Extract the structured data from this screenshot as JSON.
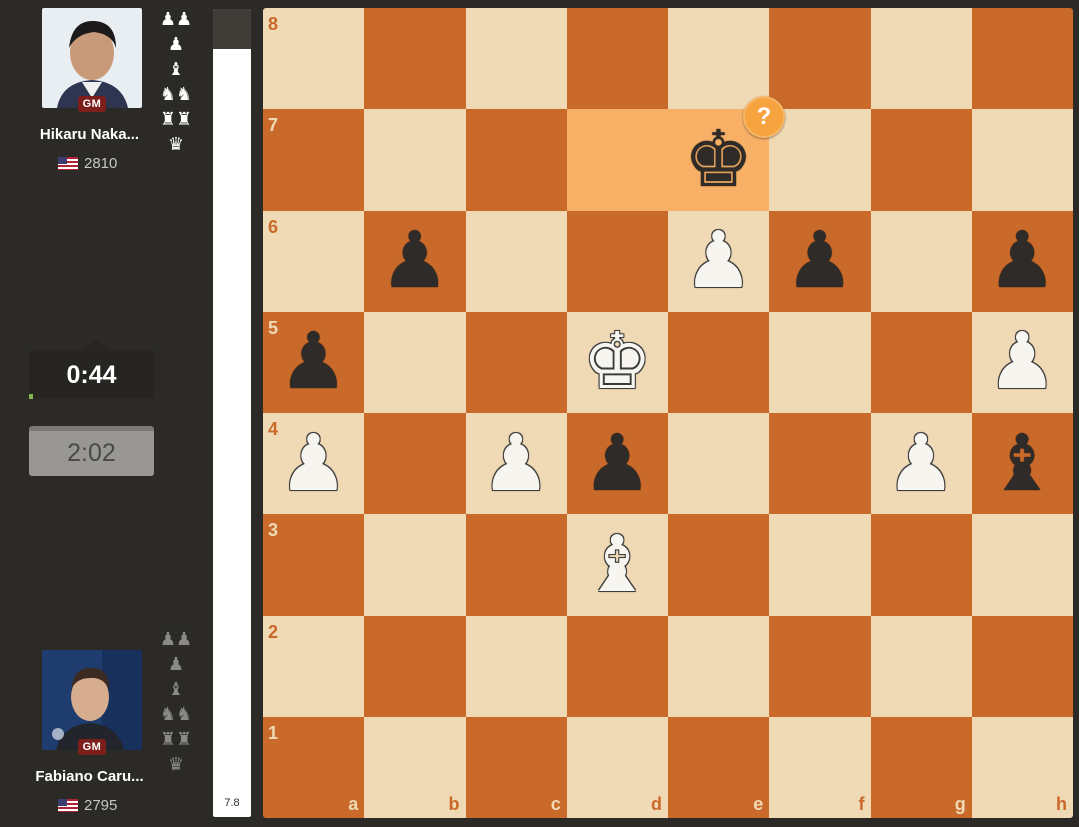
{
  "top_player": {
    "name": "Hikaru Naka...",
    "title": "GM",
    "rating": "2810",
    "clock": "0:44",
    "captured_icons": [
      "♟♟",
      "♟",
      "♝",
      "♞♞",
      "♜♜",
      "♛"
    ]
  },
  "bottom_player": {
    "name": "Fabiano Caru...",
    "title": "GM",
    "rating": "2795",
    "clock": "2:02",
    "captured_icons": [
      "♟♟",
      "♟",
      "♝",
      "♞♞",
      "♜♜",
      "♛"
    ]
  },
  "eval": {
    "score": "7.8"
  },
  "board": {
    "files": [
      "a",
      "b",
      "c",
      "d",
      "e",
      "f",
      "g",
      "h"
    ],
    "ranks": [
      "8",
      "7",
      "6",
      "5",
      "4",
      "3",
      "2",
      "1"
    ],
    "highlighted_squares": [
      "d7",
      "e7"
    ],
    "move_annotation": {
      "square": "e7",
      "symbol": "?"
    },
    "pieces": {
      "e7": "bK",
      "b6": "bP",
      "e6": "wP",
      "f6": "bP",
      "h6": "bP",
      "a5": "bP",
      "d5": "wK",
      "h5": "wP",
      "a4": "wP",
      "c4": "wP",
      "d4": "bP",
      "g4": "wP",
      "h4": "bB",
      "d3": "wB"
    }
  }
}
